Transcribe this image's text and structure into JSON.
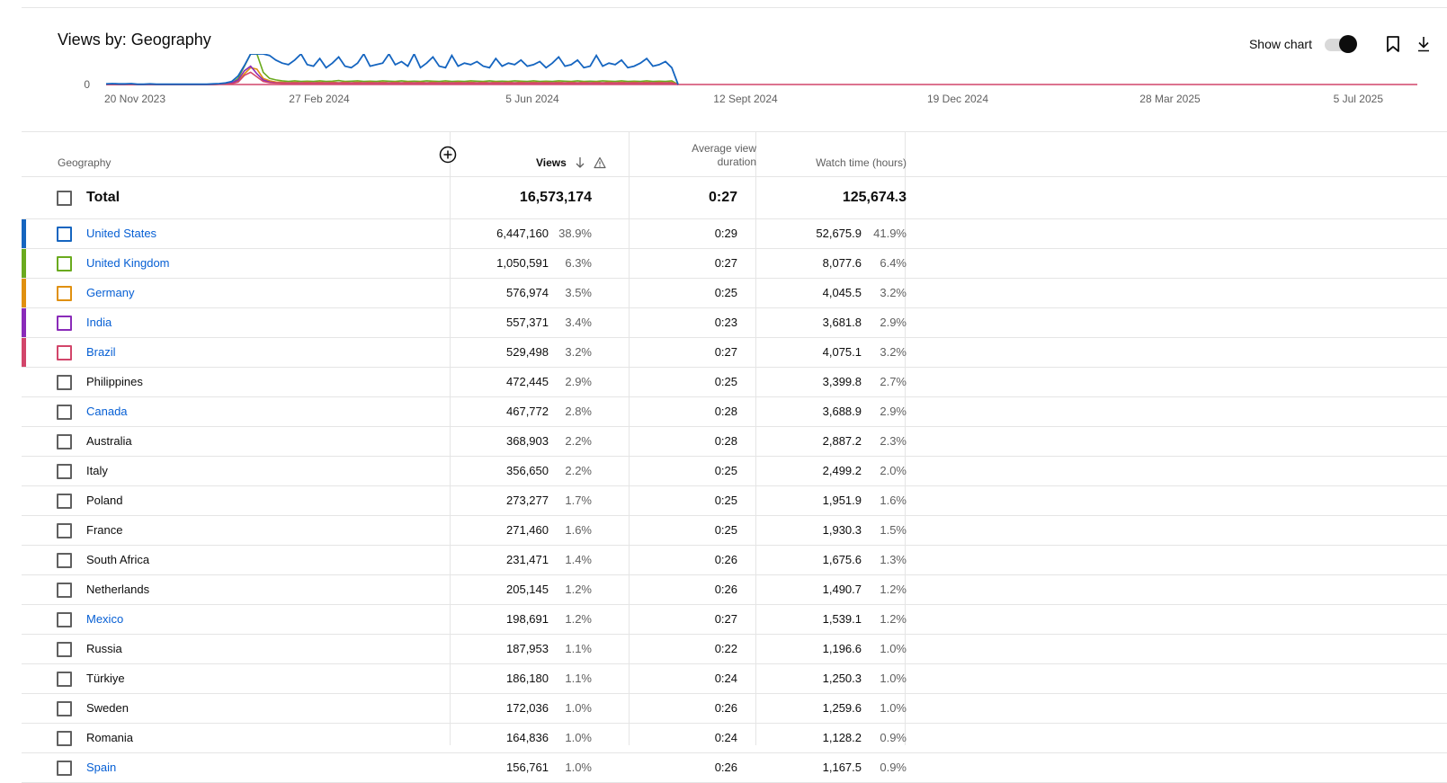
{
  "page": {
    "title": "Views by: Geography",
    "show_chart_label": "Show chart"
  },
  "colors": {
    "united_states": "#1565c0",
    "united_kingdom": "#6aaa1e",
    "germany": "#e0900f",
    "india": "#8a2bb9",
    "brazil": "#d2456a",
    "link": "#065fd4"
  },
  "icons": [
    "bookmark-icon",
    "download-icon",
    "add-column-icon",
    "sort-down-icon",
    "warning-icon"
  ],
  "chart_data": {
    "type": "line",
    "y_tick_labels": [
      "0"
    ],
    "x_tick_labels": [
      "20 Nov 2023",
      "27 Feb 2024",
      "5 Jun 2024",
      "12 Sept 2024",
      "19 Dec 2024",
      "28 Mar 2025",
      "5 Jul 2025"
    ],
    "series": [
      {
        "color": "#1565c0",
        "values": [
          0.02,
          0.03,
          0.02,
          0.02,
          0.03,
          0.01,
          0.01,
          0.02,
          0.01,
          0.01,
          0.01,
          0.01,
          0.01,
          0.01,
          0.01,
          0.01,
          0.01,
          0.02,
          0.03,
          0.05,
          0.1,
          0.28,
          0.62,
          1.2,
          1.6,
          1.3,
          0.95,
          0.8,
          0.7,
          0.65,
          0.8,
          1.0,
          0.65,
          0.6,
          0.85,
          0.55,
          0.7,
          0.9,
          0.6,
          0.55,
          0.7,
          1.05,
          0.6,
          0.65,
          0.7,
          1.05,
          0.65,
          0.75,
          0.6,
          1.0,
          0.55,
          0.7,
          0.9,
          0.6,
          0.55,
          0.95,
          0.6,
          0.7,
          0.65,
          0.75,
          0.6,
          0.55,
          0.85,
          0.6,
          0.7,
          0.65,
          0.8,
          0.6,
          0.65,
          0.75,
          0.55,
          0.7,
          0.9,
          0.6,
          0.65,
          0.8,
          0.55,
          0.6,
          0.95,
          0.6,
          0.7,
          0.65,
          0.8,
          0.55,
          0.6,
          0.7,
          0.85,
          0.6,
          0.65,
          0.75,
          0.55,
          0.0
        ]
      },
      {
        "color": "#6aaa1e",
        "values": [
          0,
          0,
          0,
          0,
          0,
          0,
          0,
          0,
          0,
          0,
          0,
          0,
          0,
          0,
          0,
          0,
          0,
          0,
          0.01,
          0.02,
          0.04,
          0.2,
          0.6,
          1.0,
          1.2,
          0.4,
          0.2,
          0.15,
          0.12,
          0.1,
          0.12,
          0.1,
          0.11,
          0.1,
          0.12,
          0.1,
          0.11,
          0.13,
          0.1,
          0.11,
          0.12,
          0.1,
          0.11,
          0.1,
          0.12,
          0.11,
          0.1,
          0.12,
          0.1,
          0.11,
          0.1,
          0.12,
          0.11,
          0.1,
          0.12,
          0.1,
          0.11,
          0.1,
          0.12,
          0.11,
          0.1,
          0.12,
          0.1,
          0.11,
          0.1,
          0.12,
          0.11,
          0.1,
          0.12,
          0.1,
          0.11,
          0.1,
          0.12,
          0.11,
          0.1,
          0.12,
          0.1,
          0.11,
          0.1,
          0.12,
          0.11,
          0.1,
          0.12,
          0.1,
          0.11,
          0.1,
          0.12,
          0.1,
          0.11,
          0.1,
          0.12,
          0.0
        ]
      },
      {
        "color": "#e0900f",
        "values": [
          0,
          0,
          0,
          0,
          0,
          0,
          0,
          0,
          0,
          0,
          0,
          0,
          0,
          0,
          0,
          0,
          0,
          0,
          0.01,
          0.02,
          0.03,
          0.1,
          0.35,
          0.55,
          0.5,
          0.2,
          0.12,
          0.08,
          0.07,
          0.06,
          0.07,
          0.06,
          0.07,
          0.06,
          0.07,
          0.06,
          0.07,
          0.06,
          0.07,
          0.06,
          0.07,
          0.06,
          0.07,
          0.06,
          0.07,
          0.06,
          0.07,
          0.06,
          0.07,
          0.06,
          0.07,
          0.06,
          0.07,
          0.06,
          0.07,
          0.06,
          0.07,
          0.06,
          0.07,
          0.06,
          0.07,
          0.06,
          0.07,
          0.06,
          0.07,
          0.06,
          0.07,
          0.06,
          0.07,
          0.06,
          0.07,
          0.06,
          0.07,
          0.06,
          0.07,
          0.06,
          0.07,
          0.06,
          0.07,
          0.06,
          0.07,
          0.06,
          0.07,
          0.06,
          0.07,
          0.06,
          0.07,
          0.06,
          0.07,
          0.06,
          0.07,
          0.0
        ]
      },
      {
        "color": "#8a2bb9",
        "values": [
          0,
          0,
          0,
          0,
          0,
          0,
          0,
          0,
          0,
          0,
          0,
          0,
          0,
          0,
          0,
          0,
          0,
          0,
          0.01,
          0.02,
          0.05,
          0.15,
          0.45,
          0.6,
          0.35,
          0.15,
          0.08,
          0.06,
          0.05,
          0.05,
          0.05,
          0.05,
          0.05,
          0.05,
          0.05,
          0.05,
          0.05,
          0.05,
          0.05,
          0.05,
          0.05,
          0.05,
          0.05,
          0.05,
          0.05,
          0.05,
          0.05,
          0.05,
          0.05,
          0.05,
          0.05,
          0.05,
          0.05,
          0.05,
          0.05,
          0.05,
          0.05,
          0.05,
          0.05,
          0.05,
          0.05,
          0.05,
          0.05,
          0.05,
          0.05,
          0.05,
          0.05,
          0.05,
          0.05,
          0.05,
          0.05,
          0.05,
          0.05,
          0.05,
          0.05,
          0.05,
          0.05,
          0.05,
          0.05,
          0.05,
          0.05,
          0.05,
          0.05,
          0.05,
          0.05,
          0.05,
          0.05,
          0.05,
          0.05,
          0.05,
          0.05,
          0.0
        ]
      },
      {
        "color": "#d2456a",
        "values": [
          0,
          0,
          0,
          0,
          0,
          0,
          0,
          0,
          0,
          0,
          0,
          0,
          0,
          0,
          0,
          0,
          0,
          0,
          0.01,
          0.02,
          0.03,
          0.08,
          0.3,
          0.4,
          0.25,
          0.1,
          0.06,
          0.05,
          0.04,
          0.04,
          0.04,
          0.04,
          0.04,
          0.04,
          0.04,
          0.04,
          0.04,
          0.04,
          0.04,
          0.04,
          0.04,
          0.04,
          0.04,
          0.04,
          0.04,
          0.04,
          0.04,
          0.04,
          0.04,
          0.04,
          0.04,
          0.04,
          0.04,
          0.04,
          0.04,
          0.04,
          0.04,
          0.04,
          0.04,
          0.04,
          0.04,
          0.04,
          0.04,
          0.04,
          0.04,
          0.04,
          0.04,
          0.04,
          0.04,
          0.04,
          0.04,
          0.04,
          0.04,
          0.04,
          0.04,
          0.04,
          0.04,
          0.04,
          0.04,
          0.04,
          0.04,
          0.04,
          0.04,
          0.04,
          0.04,
          0.04,
          0.04,
          0.04,
          0.04,
          0.04,
          0.04,
          0.0
        ]
      }
    ]
  },
  "table": {
    "headers": {
      "geography": "Geography",
      "views": "Views",
      "avg_view_duration_line1": "Average view",
      "avg_view_duration_line2": "duration",
      "watch_time": "Watch time (hours)"
    },
    "total": {
      "label": "Total",
      "views": "16,573,174",
      "avg_duration": "0:27",
      "watch_time": "125,674.3"
    },
    "rows": [
      {
        "name": "United States",
        "link": true,
        "color": "#1565c0",
        "views": "6,447,160",
        "views_pct": "38.9%",
        "avg": "0:29",
        "watch": "52,675.9",
        "watch_pct": "41.9%"
      },
      {
        "name": "United Kingdom",
        "link": true,
        "color": "#6aaa1e",
        "views": "1,050,591",
        "views_pct": "6.3%",
        "avg": "0:27",
        "watch": "8,077.6",
        "watch_pct": "6.4%"
      },
      {
        "name": "Germany",
        "link": true,
        "color": "#e0900f",
        "views": "576,974",
        "views_pct": "3.5%",
        "avg": "0:25",
        "watch": "4,045.5",
        "watch_pct": "3.2%"
      },
      {
        "name": "India",
        "link": true,
        "color": "#8a2bb9",
        "views": "557,371",
        "views_pct": "3.4%",
        "avg": "0:23",
        "watch": "3,681.8",
        "watch_pct": "2.9%"
      },
      {
        "name": "Brazil",
        "link": true,
        "color": "#d2456a",
        "views": "529,498",
        "views_pct": "3.2%",
        "avg": "0:27",
        "watch": "4,075.1",
        "watch_pct": "3.2%"
      },
      {
        "name": "Philippines",
        "link": false,
        "color": "",
        "views": "472,445",
        "views_pct": "2.9%",
        "avg": "0:25",
        "watch": "3,399.8",
        "watch_pct": "2.7%"
      },
      {
        "name": "Canada",
        "link": true,
        "color": "",
        "views": "467,772",
        "views_pct": "2.8%",
        "avg": "0:28",
        "watch": "3,688.9",
        "watch_pct": "2.9%"
      },
      {
        "name": "Australia",
        "link": false,
        "color": "",
        "views": "368,903",
        "views_pct": "2.2%",
        "avg": "0:28",
        "watch": "2,887.2",
        "watch_pct": "2.3%"
      },
      {
        "name": "Italy",
        "link": false,
        "color": "",
        "views": "356,650",
        "views_pct": "2.2%",
        "avg": "0:25",
        "watch": "2,499.2",
        "watch_pct": "2.0%"
      },
      {
        "name": "Poland",
        "link": false,
        "color": "",
        "views": "273,277",
        "views_pct": "1.7%",
        "avg": "0:25",
        "watch": "1,951.9",
        "watch_pct": "1.6%"
      },
      {
        "name": "France",
        "link": false,
        "color": "",
        "views": "271,460",
        "views_pct": "1.6%",
        "avg": "0:25",
        "watch": "1,930.3",
        "watch_pct": "1.5%"
      },
      {
        "name": "South Africa",
        "link": false,
        "color": "",
        "views": "231,471",
        "views_pct": "1.4%",
        "avg": "0:26",
        "watch": "1,675.6",
        "watch_pct": "1.3%"
      },
      {
        "name": "Netherlands",
        "link": false,
        "color": "",
        "views": "205,145",
        "views_pct": "1.2%",
        "avg": "0:26",
        "watch": "1,490.7",
        "watch_pct": "1.2%"
      },
      {
        "name": "Mexico",
        "link": true,
        "color": "",
        "views": "198,691",
        "views_pct": "1.2%",
        "avg": "0:27",
        "watch": "1,539.1",
        "watch_pct": "1.2%"
      },
      {
        "name": "Russia",
        "link": false,
        "color": "",
        "views": "187,953",
        "views_pct": "1.1%",
        "avg": "0:22",
        "watch": "1,196.6",
        "watch_pct": "1.0%"
      },
      {
        "name": "Türkiye",
        "link": false,
        "color": "",
        "views": "186,180",
        "views_pct": "1.1%",
        "avg": "0:24",
        "watch": "1,250.3",
        "watch_pct": "1.0%"
      },
      {
        "name": "Sweden",
        "link": false,
        "color": "",
        "views": "172,036",
        "views_pct": "1.0%",
        "avg": "0:26",
        "watch": "1,259.6",
        "watch_pct": "1.0%"
      },
      {
        "name": "Romania",
        "link": false,
        "color": "",
        "views": "164,836",
        "views_pct": "1.0%",
        "avg": "0:24",
        "watch": "1,128.2",
        "watch_pct": "0.9%"
      },
      {
        "name": "Spain",
        "link": true,
        "color": "",
        "views": "156,761",
        "views_pct": "1.0%",
        "avg": "0:26",
        "watch": "1,167.5",
        "watch_pct": "0.9%"
      }
    ]
  }
}
